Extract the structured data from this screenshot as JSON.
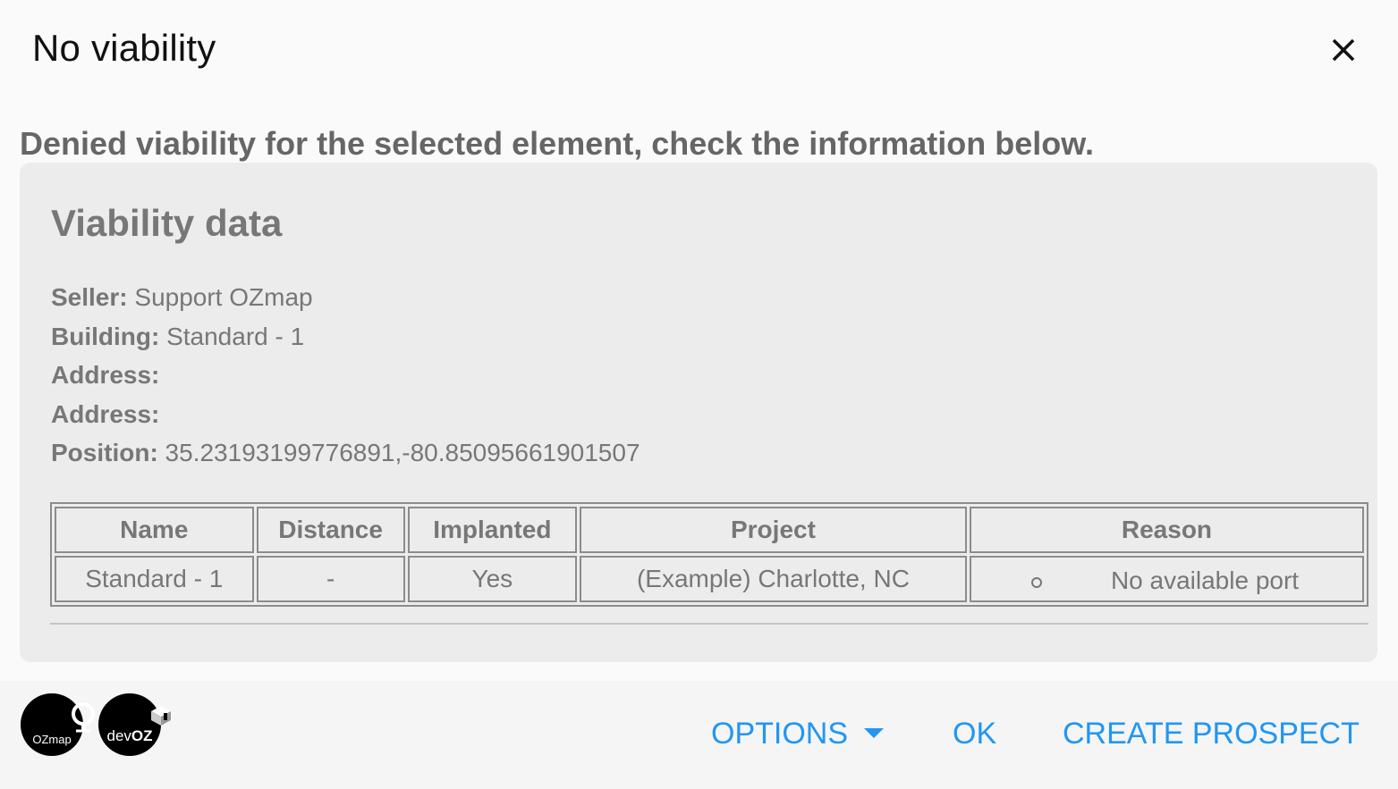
{
  "dialog": {
    "title": "No viability",
    "subtitle": "Denied viability for the selected element, check the information below."
  },
  "card": {
    "title": "Viability data",
    "info": [
      {
        "label": "Seller:",
        "value": "Support OZmap"
      },
      {
        "label": "Building:",
        "value": "Standard - 1"
      },
      {
        "label": "Address:",
        "value": ""
      },
      {
        "label": "Address:",
        "value": ""
      },
      {
        "label": "Position:",
        "value": "35.23193199776891,-80.85095661901507"
      }
    ],
    "table": {
      "headers": [
        "Name",
        "Distance",
        "Implanted",
        "Project",
        "Reason"
      ],
      "rows": [
        {
          "name": "Standard - 1",
          "distance": "-",
          "implanted": "Yes",
          "project": "(Example) Charlotte, NC",
          "reason": "No available port"
        }
      ]
    }
  },
  "footer": {
    "logos": {
      "ozmap_text": "OZmap",
      "devoz_prefix": "dev",
      "devoz_suffix": "OZ"
    },
    "buttons": {
      "options": "OPTIONS",
      "ok": "OK",
      "create_prospect": "CREATE PROSPECT"
    }
  },
  "colors": {
    "accent": "#2196f3",
    "card_bg": "#ececec",
    "text_muted": "#777777"
  }
}
